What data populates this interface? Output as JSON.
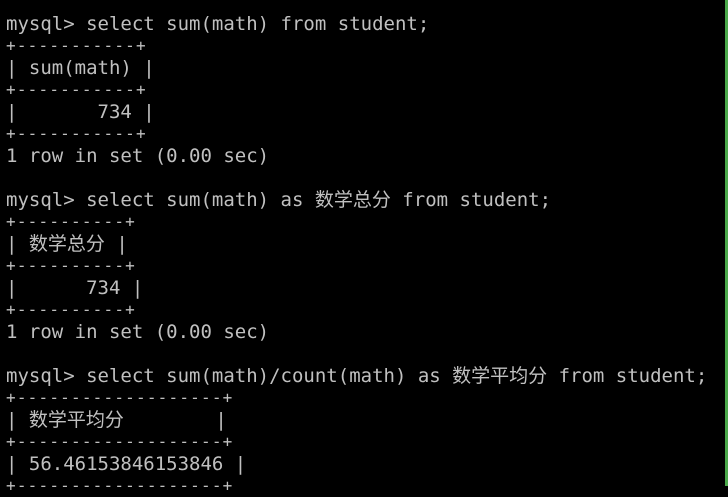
{
  "prompt": "mysql>",
  "blocks": [
    {
      "command": "select sum(math) from student;",
      "border": "+-----------+",
      "header": "| sum(math) |",
      "value": "|       734 |",
      "result": "1 row in set (0.00 sec)"
    },
    {
      "command": "select sum(math) as 数学总分 from student;",
      "border": "+----------+",
      "header": "| 数学总分 |",
      "value": "|      734 |",
      "result": "1 row in set (0.00 sec)"
    },
    {
      "command": "select sum(math)/count(math) as 数学平均分 from student;",
      "border": "+-------------------+",
      "header": "| 数学平均分        |",
      "value": "| 56.46153846153846 |"
    }
  ]
}
